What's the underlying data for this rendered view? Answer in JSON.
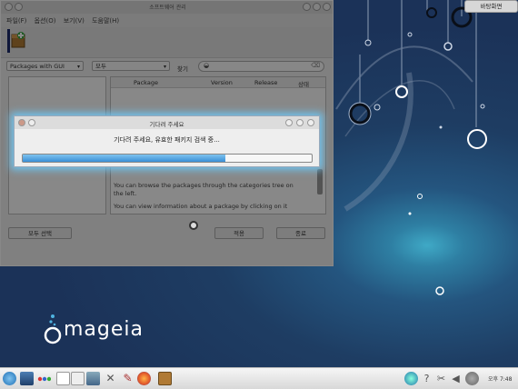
{
  "main_window": {
    "title": "소프트웨어 관리",
    "menu": [
      "파일(F)",
      "옵션(O)",
      "보기(V)",
      "도움말(H)"
    ],
    "filter_combo": "Packages with GUI",
    "status_combo": "모두",
    "search_label": "찾기",
    "columns": [
      "Package",
      "Version",
      "Release",
      "상태"
    ],
    "info_lines": [
      "You can browse the packages through the categories tree on the left.",
      "You can view information about a package by clicking on it"
    ],
    "buttons": {
      "select_all": "모두 선택",
      "apply": "적용",
      "quit": "종료"
    }
  },
  "dialog": {
    "title": "기다려 주세요",
    "message": "기다려 주세요, 유효한 패키지 검색 중...",
    "progress": 0.7
  },
  "desktop": {
    "show_desktop_button": "바탕화면",
    "logo_text": "mageia"
  },
  "taskbar": {
    "clock": "오후 7:48",
    "icons": [
      "kde-menu-icon",
      "desktop-icon",
      "activities-icon",
      "pager-icon",
      "pager-icon-2",
      "files-icon",
      "config-icon",
      "firefox-icon",
      "rpmdrake-icon",
      "network-icon",
      "help-icon",
      "battery-icon",
      "volume-icon",
      "update-icon"
    ]
  },
  "colors": {
    "accent": "#3a8fd6",
    "desktop": "#1e3d63"
  }
}
